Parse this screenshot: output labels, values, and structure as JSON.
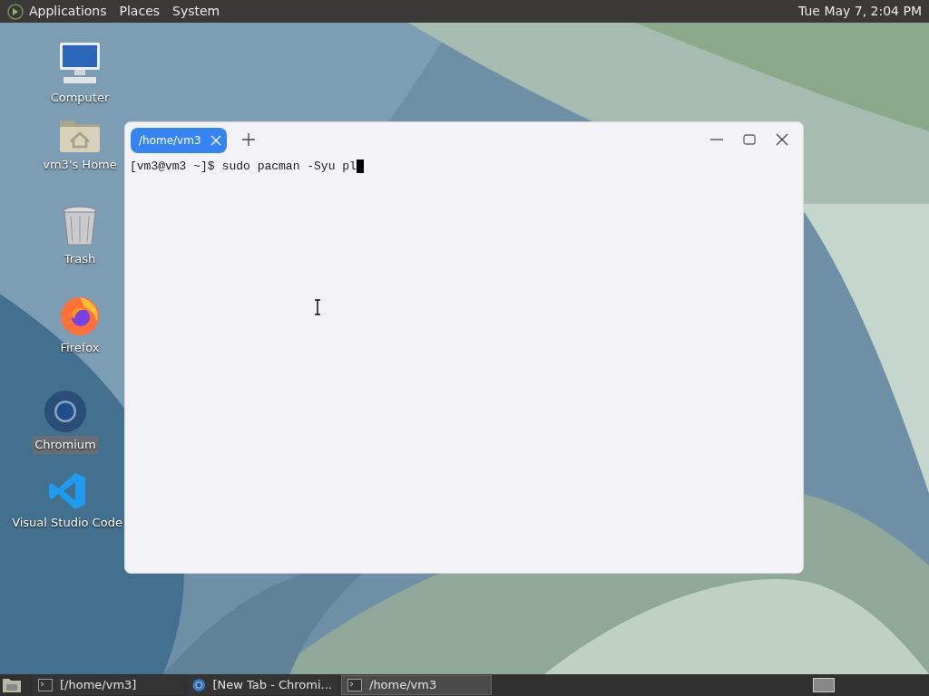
{
  "top_panel": {
    "menus": [
      "Applications",
      "Places",
      "System"
    ],
    "clock": "Tue May 7, 2:04 PM"
  },
  "desktop_icons": [
    {
      "kind": "computer",
      "label": "Computer",
      "selected": false
    },
    {
      "kind": "home",
      "label": "vm3's Home",
      "selected": false
    },
    {
      "kind": "trash",
      "label": "Trash",
      "selected": false
    },
    {
      "kind": "firefox",
      "label": "Firefox",
      "selected": false
    },
    {
      "kind": "chromium",
      "label": "Chromium",
      "selected": true
    },
    {
      "kind": "vscode",
      "label": "Visual Studio Code",
      "selected": false
    }
  ],
  "terminal": {
    "tabs": [
      {
        "title": "/home/vm3",
        "selected": true
      }
    ],
    "lines": [
      {
        "prompt": "[vm3@vm3 ~]$",
        "command": "sudo pacman -Syu pl"
      }
    ]
  },
  "taskbar": {
    "items": [
      {
        "kind": "terminal",
        "label": "[/home/vm3]",
        "selected": false
      },
      {
        "kind": "browser",
        "label": "[New Tab - Chromi...",
        "selected": false
      },
      {
        "kind": "terminal",
        "label": "/home/vm3",
        "selected": true
      }
    ]
  }
}
